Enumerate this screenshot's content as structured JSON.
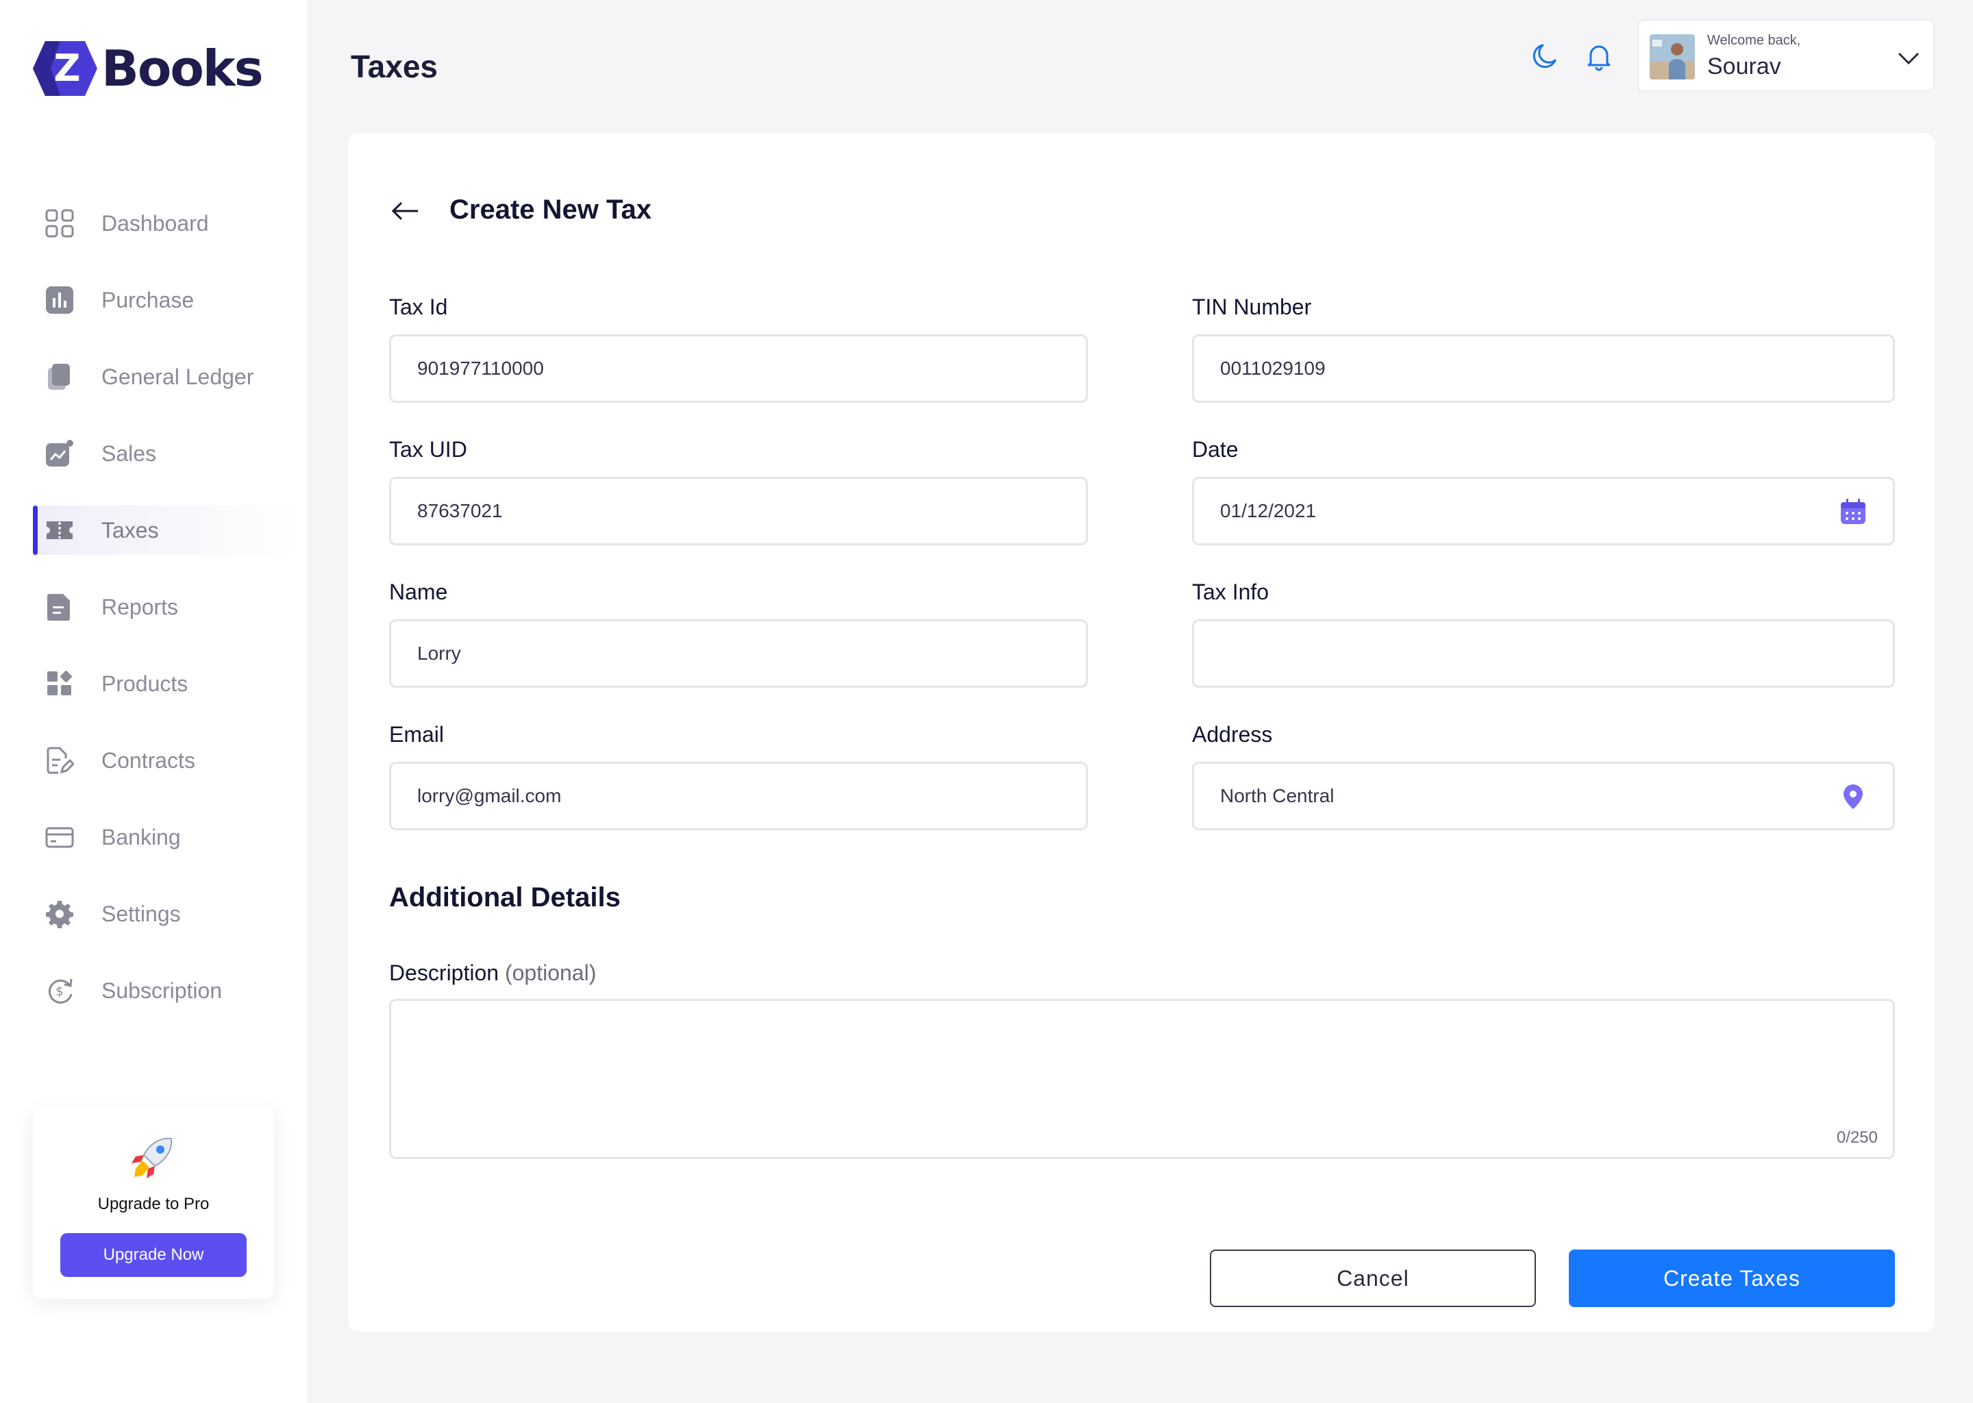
{
  "app": {
    "logo_text": "Books",
    "logo_letter": "Z",
    "accent_color": "#3b2fe0",
    "primary_button_color": "#1677ff"
  },
  "sidebar": {
    "items": [
      {
        "label": "Dashboard",
        "icon": "grid-icon",
        "active": false
      },
      {
        "label": "Purchase",
        "icon": "bar-chart-icon",
        "active": false
      },
      {
        "label": "General Ledger",
        "icon": "copy-icon",
        "active": false
      },
      {
        "label": "Sales",
        "icon": "trend-chart-icon",
        "active": false
      },
      {
        "label": "Taxes",
        "icon": "ticket-icon",
        "active": true
      },
      {
        "label": "Reports",
        "icon": "document-icon",
        "active": false
      },
      {
        "label": "Products",
        "icon": "widgets-icon",
        "active": false
      },
      {
        "label": "Contracts",
        "icon": "document-edit-icon",
        "active": false
      },
      {
        "label": "Banking",
        "icon": "credit-card-icon",
        "active": false
      },
      {
        "label": "Settings",
        "icon": "gear-icon",
        "active": false
      },
      {
        "label": "Subscription",
        "icon": "dollar-refresh-icon",
        "active": false
      }
    ],
    "upgrade": {
      "title": "Upgrade to Pro",
      "button": "Upgrade Now"
    }
  },
  "header": {
    "title": "Taxes",
    "user": {
      "welcome": "Welcome back,",
      "name": "Sourav"
    }
  },
  "form": {
    "title": "Create New Tax",
    "fields": {
      "tax_id": {
        "label": "Tax Id",
        "value": "901977110000"
      },
      "tin_number": {
        "label": "TIN Number",
        "value": "0011029109"
      },
      "tax_uid": {
        "label": "Tax UID",
        "value": "87637021"
      },
      "date": {
        "label": "Date",
        "value": "01/12/2021"
      },
      "name": {
        "label": "Name",
        "value": "Lorry"
      },
      "tax_info": {
        "label": "Tax Info",
        "value": ""
      },
      "email": {
        "label": "Email",
        "value": "lorry@gmail.com"
      },
      "address": {
        "label": "Address",
        "value": "North Central"
      }
    },
    "additional_title": "Additional Details",
    "description": {
      "label": "Description",
      "optional": "(optional)",
      "counter": "0/250"
    },
    "cancel_label": "Cancel",
    "submit_label": "Create Taxes"
  }
}
